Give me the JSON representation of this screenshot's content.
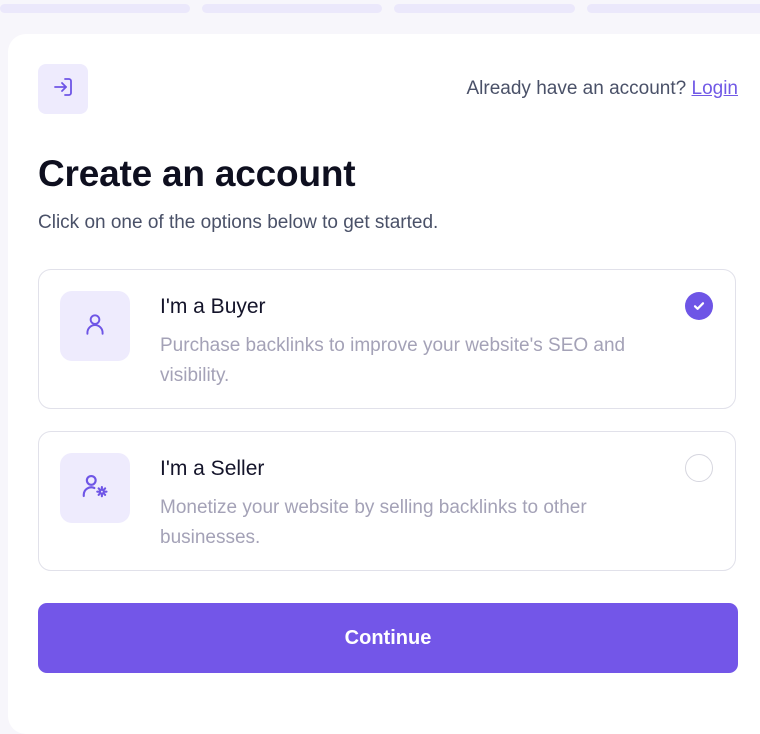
{
  "header": {
    "already_text": "Already have an account?",
    "login_label": "Login",
    "login_icon": "login-arrow-icon"
  },
  "main": {
    "title": "Create an account",
    "subtitle": "Click on one of the options below to get started."
  },
  "options": [
    {
      "title": "I'm a Buyer",
      "description": "Purchase backlinks to improve your website's SEO and visibility.",
      "icon": "user-icon",
      "selected": true
    },
    {
      "title": "I'm a Seller",
      "description": "Monetize your website by selling backlinks to other businesses.",
      "icon": "user-gear-icon",
      "selected": false
    }
  ],
  "continue_label": "Continue",
  "colors": {
    "accent": "#7356e8",
    "icon_bg": "#eeebfd",
    "text_primary": "#0e0f1f",
    "text_muted": "#a4a2b7"
  }
}
